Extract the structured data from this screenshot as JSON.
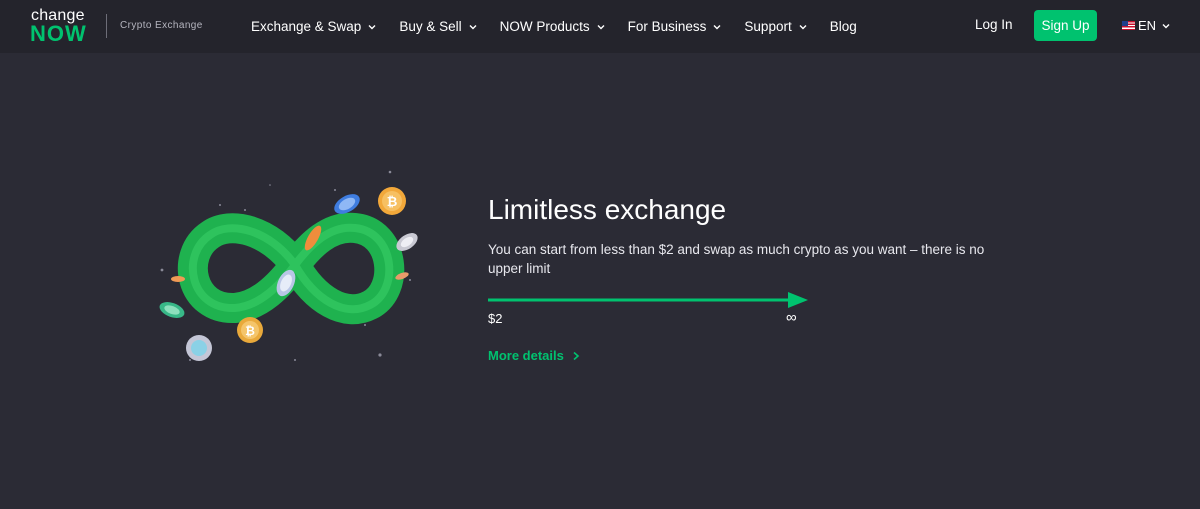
{
  "brand": {
    "logo_top": "change",
    "logo_bottom": "NOW",
    "tagline": "Crypto Exchange"
  },
  "nav": {
    "items": [
      {
        "label": "Exchange & Swap",
        "has_dropdown": true
      },
      {
        "label": "Buy & Sell",
        "has_dropdown": true
      },
      {
        "label": "NOW Products",
        "has_dropdown": true
      },
      {
        "label": "For Business",
        "has_dropdown": true
      },
      {
        "label": "Support",
        "has_dropdown": true
      },
      {
        "label": "Blog",
        "has_dropdown": false
      }
    ],
    "login_label": "Log In",
    "signup_label": "Sign Up",
    "language": "EN"
  },
  "hero": {
    "title": "Limitless exchange",
    "description": "You can start from less than $2 and swap as much crypto as you want – there is no upper limit",
    "range_min": "$2",
    "range_max": "∞",
    "more_label": "More details"
  },
  "colors": {
    "accent": "#00c26f",
    "background": "#2b2b35",
    "header": "#24242c"
  },
  "icons": [
    "chevron-down-icon",
    "us-flag-icon",
    "chevron-right-icon",
    "infinity-illustration",
    "bitcoin-coin-icon"
  ]
}
